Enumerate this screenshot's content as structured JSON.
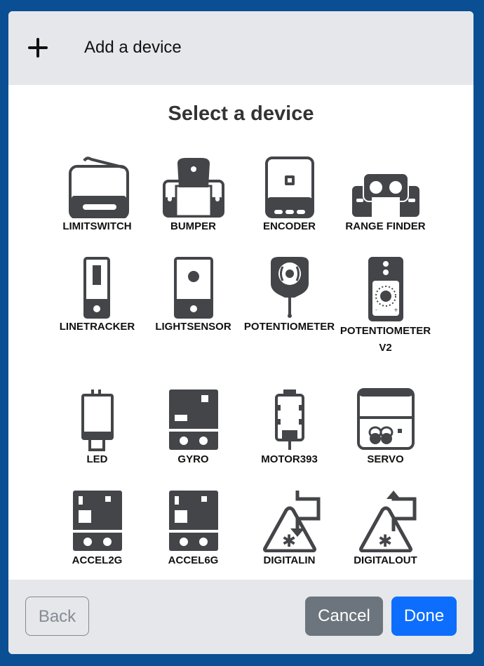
{
  "header": {
    "title": "Add a device",
    "icon": "plus-icon"
  },
  "selector": {
    "title": "Select a device"
  },
  "devices": [
    {
      "label": "LIMITSWITCH",
      "icon": "limitswitch-icon"
    },
    {
      "label": "BUMPER",
      "icon": "bumper-icon"
    },
    {
      "label": "ENCODER",
      "icon": "encoder-icon"
    },
    {
      "label": "RANGE FINDER",
      "icon": "range-finder-icon"
    },
    {
      "label": "LINETRACKER",
      "icon": "linetracker-icon"
    },
    {
      "label": "LIGHTSENSOR",
      "icon": "lightsensor-icon"
    },
    {
      "label": "POTENTIOMETER",
      "icon": "potentiometer-icon"
    },
    {
      "label": "POTENTIOMETER V2",
      "icon": "potentiometer-v2-icon"
    },
    {
      "label": "LED",
      "icon": "led-icon"
    },
    {
      "label": "GYRO",
      "icon": "gyro-icon"
    },
    {
      "label": "MOTOR393",
      "icon": "motor393-icon"
    },
    {
      "label": "SERVO",
      "icon": "servo-icon"
    },
    {
      "label": "ACCEL2G",
      "icon": "accel2g-icon"
    },
    {
      "label": "ACCEL6G",
      "icon": "accel6g-icon"
    },
    {
      "label": "DIGITALIN",
      "icon": "digitalin-icon"
    },
    {
      "label": "DIGITALOUT",
      "icon": "digitalout-icon"
    }
  ],
  "footer": {
    "back_label": "Back",
    "cancel_label": "Cancel",
    "done_label": "Done"
  },
  "colors": {
    "frame": "#0a4f94",
    "header_bg": "#e6e7eb",
    "icon": "#444549",
    "done": "#0d6efd",
    "cancel": "#6c757d"
  }
}
